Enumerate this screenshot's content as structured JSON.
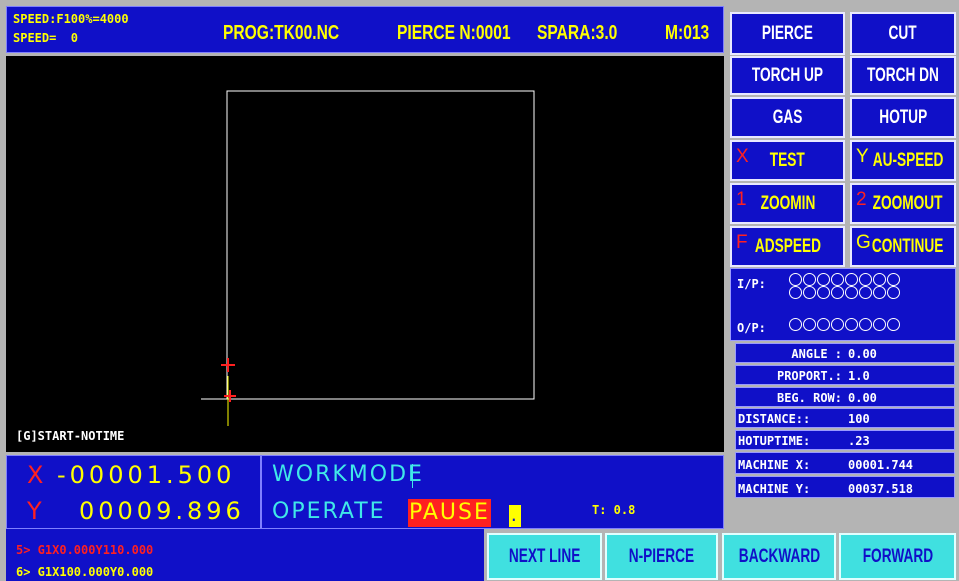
{
  "header": {
    "speed_line1": "SPEED:F100%=4000",
    "speed_line2": "SPEED=  0",
    "prog": "PROG:TK00.NC",
    "pierce": "PIERCE N:0001",
    "spara": "SPARA:3.0",
    "m": "M:013"
  },
  "right_buttons": [
    {
      "label": "PIERCE",
      "key": ""
    },
    {
      "label": "CUT",
      "key": ""
    },
    {
      "label": "TORCH UP",
      "key": ""
    },
    {
      "label": "TORCH DN",
      "key": ""
    },
    {
      "label": "GAS",
      "key": ""
    },
    {
      "label": "HOTUP",
      "key": ""
    },
    {
      "label": "TEST",
      "key": "X"
    },
    {
      "label": "AU-SPEED",
      "key": "Y"
    },
    {
      "label": "ZOOMIN",
      "key": "1"
    },
    {
      "label": "ZOOMOUT",
      "key": "2"
    },
    {
      "label": "ADSPEED",
      "key": "F"
    },
    {
      "label": "CONTINUE",
      "key": "G"
    }
  ],
  "io": {
    "ip_label": "I/P:",
    "op_label": "O/P:"
  },
  "params": [
    {
      "label": "ANGLE :",
      "value": "0.00"
    },
    {
      "label": "PROPORT.:",
      "value": "1.0"
    },
    {
      "label": "BEG. ROW:",
      "value": "0.00"
    },
    {
      "label": "DISTANCE::",
      "value": "100"
    },
    {
      "label": "HOTUPTIME:",
      "value": ".23"
    },
    {
      "label": "MACHINE X:",
      "value": "00001.744"
    },
    {
      "label": "MACHINE Y:",
      "value": "00037.518"
    }
  ],
  "canvas": {
    "status_text": "[G]START-NOTIME"
  },
  "coords": {
    "x_label": "X",
    "x_value": "-00001.500",
    "y_label": "Y",
    "y_value": "00009.896"
  },
  "mode": {
    "workmode": "WORKMODE",
    "operate": "OPERATE",
    "pause": "PAUSE",
    "cursor": ".",
    "t": "T: 0.8"
  },
  "program_lines": {
    "line5": "5> G1X0.000Y110.000",
    "line6": "6> G1X100.000Y0.000"
  },
  "bottom_buttons": [
    {
      "label": "NEXT LINE"
    },
    {
      "label": "N-PIERCE"
    },
    {
      "label": "BACKWARD"
    },
    {
      "label": "FORWARD"
    }
  ]
}
